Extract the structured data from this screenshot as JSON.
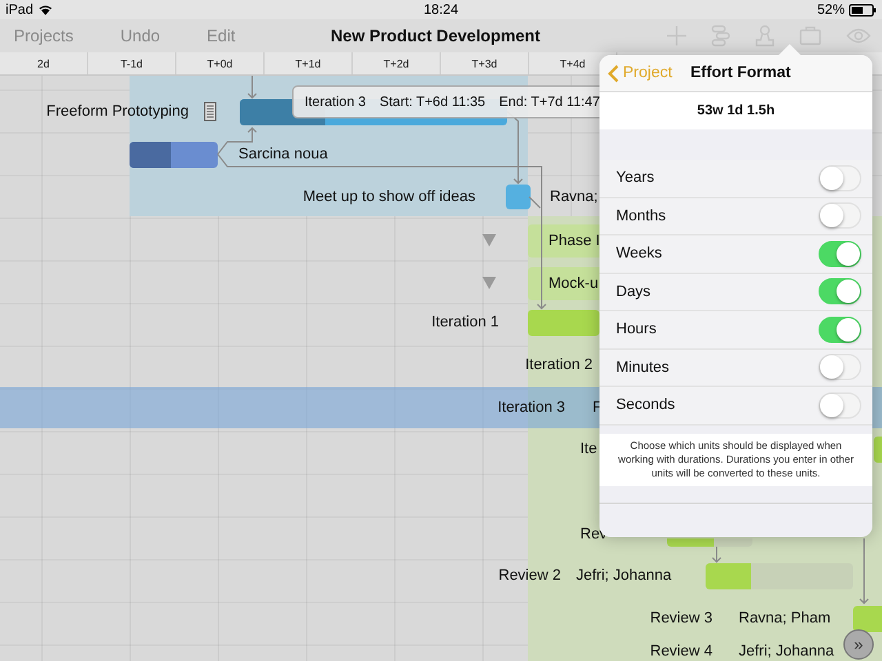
{
  "status_bar": {
    "device": "iPad",
    "time": "18:24",
    "battery": "52%"
  },
  "toolbar": {
    "left_buttons": [
      "Projects",
      "Undo",
      "Edit"
    ],
    "title": "New Product Development"
  },
  "timeline": {
    "ticks": [
      "2d",
      "T-1d",
      "T+0d",
      "T+1d",
      "T+2d",
      "T+3d",
      "T+4d"
    ]
  },
  "scroll_button": "»",
  "tooltip": {
    "task": "Iteration 3",
    "start": "Start: T+6d 11:35",
    "end": "End: T+7d 11:47"
  },
  "tasks": [
    {
      "kind": "task",
      "label": "Freeform Prototyping",
      "note": true,
      "level": 0.32,
      "selected": false
    },
    {
      "kind": "task",
      "label": "Sarcina noua",
      "level": 0.47,
      "selected": false
    },
    {
      "kind": "milestone",
      "label": "Meet up to show off ideas",
      "assignee": "Ravna;",
      "selected": false
    },
    {
      "kind": "group",
      "label": "Phase I",
      "selected": false
    },
    {
      "kind": "group",
      "label": "Mock-u",
      "selected": false
    },
    {
      "kind": "task",
      "label": "Iteration 1",
      "selected": false
    },
    {
      "kind": "label",
      "label": "Iteration 2",
      "selected": false
    },
    {
      "kind": "label",
      "label": "Iteration 3",
      "assignee": "F",
      "selected": true
    },
    {
      "kind": "task",
      "label": "Ite",
      "selected": false
    },
    {
      "kind": "task",
      "label": "Rev",
      "level": 0.55,
      "selected": false
    },
    {
      "kind": "task",
      "label": "Review 2",
      "assignee": "Jefri; Johanna",
      "level": 0.31,
      "selected": false
    },
    {
      "kind": "task",
      "label": "Review 3",
      "assignee": "Ravna; Pham",
      "selected": false
    },
    {
      "kind": "label",
      "label": "Review 4",
      "assignee": "Jefri; Johanna",
      "selected": false
    }
  ],
  "popover": {
    "back": "Project",
    "title": "Effort Format",
    "sample": "53w 1d 1.5h",
    "units": [
      {
        "label": "Years",
        "on": false
      },
      {
        "label": "Months",
        "on": false
      },
      {
        "label": "Weeks",
        "on": true
      },
      {
        "label": "Days",
        "on": true
      },
      {
        "label": "Hours",
        "on": true
      },
      {
        "label": "Minutes",
        "on": false
      },
      {
        "label": "Seconds",
        "on": false
      }
    ],
    "footnote": "Choose which units should be displayed when working with durations. Durations you enter in other units will be converted to these units."
  }
}
